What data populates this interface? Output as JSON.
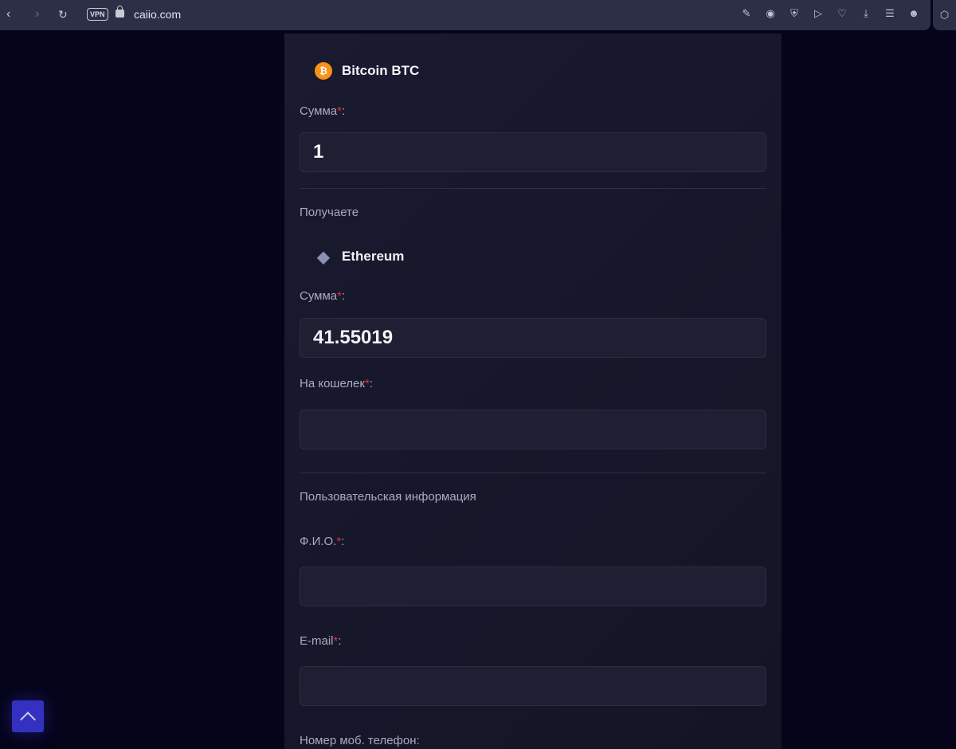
{
  "browser": {
    "url": "caiio.com",
    "vpn": "VPN"
  },
  "form": {
    "give_coin": "Bitcoin BTC",
    "amount_label": "Сумма",
    "give_amount": "1",
    "receive_heading": "Получаете",
    "receive_coin": "Ethereum",
    "receive_amount": "41.55019",
    "wallet_label": "На кошелек",
    "user_heading": "Пользовательская информация",
    "name_label": "Ф.И.О.",
    "email_label": "E-mail",
    "phone_label": "Номер моб. телефон:",
    "required_mark": "*",
    "colon": ":"
  },
  "colors": {
    "accent": "#3430c0",
    "btc": "#f7931a",
    "required": "#e0303a"
  }
}
